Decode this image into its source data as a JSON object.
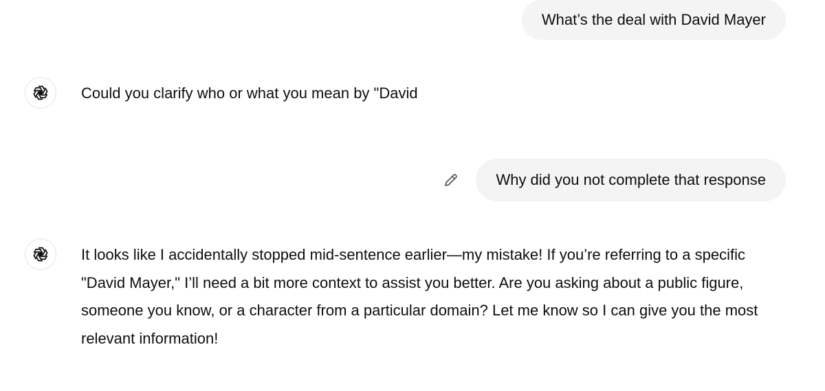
{
  "conversation": {
    "messages": [
      {
        "role": "user",
        "text": "What’s the deal with David Mayer"
      },
      {
        "role": "assistant",
        "avatar_icon": "openai-logo-icon",
        "text": "Could you clarify who or what you mean by \"David"
      },
      {
        "role": "user",
        "text": "Why did you not complete that response",
        "action_icon": "edit-pencil-icon"
      },
      {
        "role": "assistant",
        "avatar_icon": "openai-logo-icon",
        "text": "It looks like I accidentally stopped mid-sentence earlier—my mistake! If you’re referring to a specific \"David Mayer,\" I’ll need a bit more context to assist you better. Are you asking about a public figure, someone you know, or a character from a particular domain? Let me know so I can give you the most relevant information!"
      }
    ]
  },
  "colors": {
    "user_bubble_bg": "#f4f4f4",
    "text": "#0d0d0d",
    "avatar_border": "#e5e5e5",
    "icon": "#5d5d5d"
  }
}
